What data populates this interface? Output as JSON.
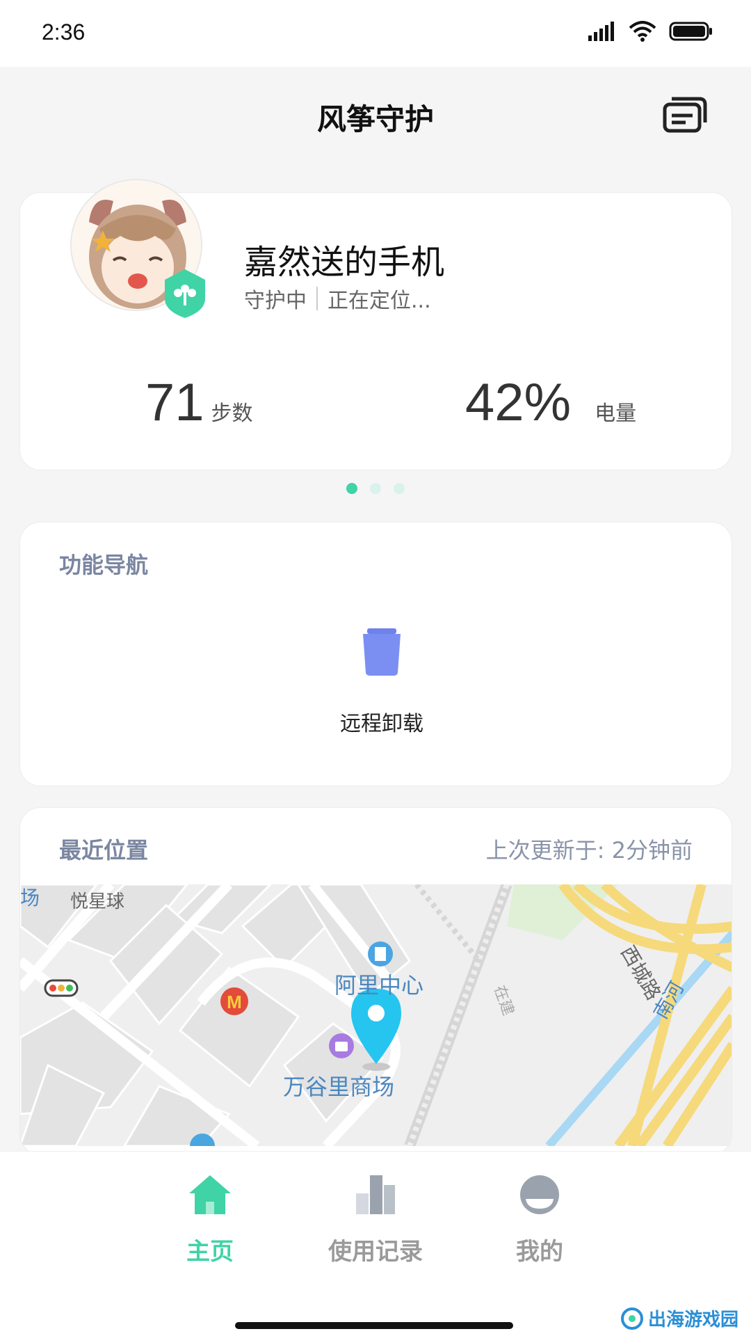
{
  "status_bar": {
    "time": "2:36"
  },
  "header": {
    "title": "风筝守护",
    "action_icon": "cards-icon"
  },
  "profile": {
    "device_name": "嘉然送的手机",
    "status": "守护中",
    "location_status": "正在定位...",
    "steps_value": "71",
    "steps_label": "步数",
    "battery_value": "42%",
    "battery_label": "电量",
    "pager_count": 3,
    "pager_active": 0
  },
  "nav_section": {
    "title": "功能导航",
    "items": [
      {
        "label": "远程卸载",
        "icon": "trash-icon"
      }
    ]
  },
  "location": {
    "title": "最近位置",
    "updated": "上次更新于: 2分钟前",
    "map_labels": {
      "mall_edge": "场",
      "star_ball": "悦星球",
      "ali_center": "阿里中心",
      "wangu_mall": "万谷里商场",
      "west_road": "西城路",
      "nan_river": "南河",
      "construction": "在建"
    }
  },
  "tabs": [
    {
      "label": "主页",
      "icon": "home-icon",
      "active": true
    },
    {
      "label": "使用记录",
      "icon": "bar-chart-icon",
      "active": false
    },
    {
      "label": "我的",
      "icon": "profile-icon",
      "active": false
    }
  ],
  "watermark": "出海游戏园",
  "colors": {
    "accent": "#3fd3a6",
    "trash": "#7b8ff2",
    "pin": "#25c5f0"
  }
}
